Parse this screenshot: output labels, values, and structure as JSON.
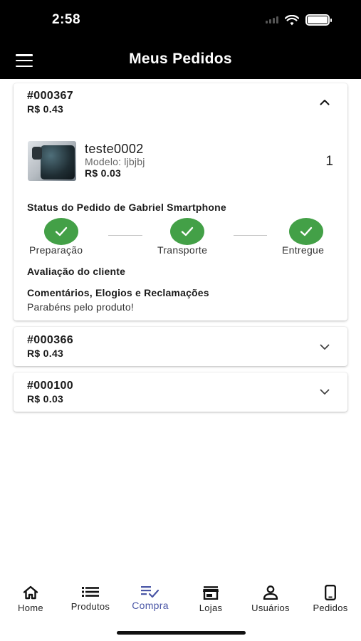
{
  "status_bar": {
    "time": "2:58"
  },
  "app_bar": {
    "title": "Meus Pedidos",
    "menu_icon": "hamburger-icon"
  },
  "orders": [
    {
      "id": "#000367",
      "total": "R$ 0.43",
      "expanded": true,
      "item": {
        "name": "teste0002",
        "model": "Modelo: ljbjbj",
        "price": "R$ 0.03",
        "quantity": "1"
      },
      "status_title": "Status do Pedido de Gabriel Smartphone",
      "steps": [
        {
          "label": "Preparação",
          "done": true
        },
        {
          "label": "Transporte",
          "done": true
        },
        {
          "label": "Entregue",
          "done": true
        }
      ],
      "evaluation_title": "Avaliação do cliente",
      "comments_title": "Comentários, Elogios e Reclamações",
      "comments_text": "Parabéns pelo produto!"
    },
    {
      "id": "#000366",
      "total": "R$ 0.43",
      "expanded": false
    },
    {
      "id": "#000100",
      "total": "R$ 0.03",
      "expanded": false
    }
  ],
  "bottom_nav": [
    {
      "label": "Home",
      "icon": "home-icon"
    },
    {
      "label": "Produtos",
      "icon": "list-icon"
    },
    {
      "label": "Compra",
      "icon": "checklist-icon",
      "active": true
    },
    {
      "label": "Lojas",
      "icon": "store-icon"
    },
    {
      "label": "Usuários",
      "icon": "user-icon"
    },
    {
      "label": "Pedidos",
      "icon": "smartphone-icon"
    }
  ],
  "colors": {
    "success": "#43a047",
    "active_nav": "#4a56a6",
    "app_bar": "#000000"
  }
}
